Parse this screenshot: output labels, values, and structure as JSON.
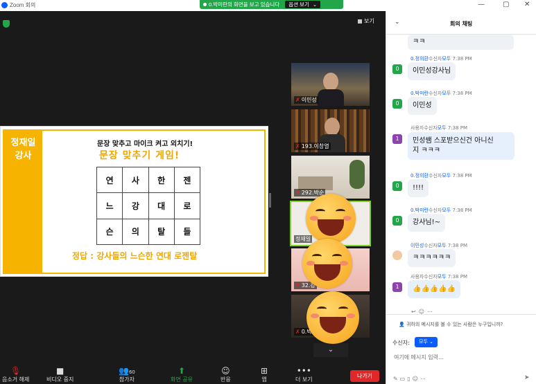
{
  "window": {
    "title": "Zoom 회의"
  },
  "share_banner": {
    "text": "0.박미란의 화면을 보고 있습니다",
    "options_label": "옵션 보기"
  },
  "meeting": {
    "view_label": "보기"
  },
  "slide": {
    "side_text_line1": "정재일",
    "side_text_line2": "강사",
    "question": "문장 맞추고 마이크 켜고 외치기!",
    "title": "문장 맞추기 게임!",
    "grid": [
      [
        "연",
        "사",
        "한",
        "젠"
      ],
      [
        "느",
        "강",
        "대",
        "로"
      ],
      [
        "슨",
        "의",
        "탈",
        "들"
      ]
    ],
    "answer": "정답 : 강사들의 느슨한 연대 로젠탈"
  },
  "participants": [
    {
      "name": "이민성",
      "muted": true
    },
    {
      "name": "193.이창열",
      "muted": true
    },
    {
      "name": "292.박순",
      "muted": true
    },
    {
      "name": "정재일",
      "muted": false
    },
    {
      "name": "32.강",
      "muted": true
    },
    {
      "name": "0.박",
      "muted": true
    }
  ],
  "toolbar": {
    "items": [
      {
        "label": "음소거 해제",
        "icon": "microphone-muted-icon"
      },
      {
        "label": "비디오 중지",
        "icon": "video-camera-icon"
      },
      {
        "label": "참가자",
        "icon": "participants-icon",
        "count": "60"
      },
      {
        "label": "화면 공유",
        "icon": "share-screen-icon"
      },
      {
        "label": "반응",
        "icon": "reaction-icon"
      },
      {
        "label": "앱",
        "icon": "apps-icon"
      },
      {
        "label": "더 보기",
        "icon": "more-icon"
      }
    ],
    "leave_label": "나가기"
  },
  "chat": {
    "title": "회의 채팅",
    "messages": [
      {
        "sender": "",
        "to": "",
        "time": "",
        "text": "ㅋㅋ",
        "avatar": ""
      },
      {
        "sender": "0.정의환",
        "to_label": "수신자",
        "to": "모두",
        "time": "7:38 PM",
        "text": "이민성강사님",
        "avatar": "0"
      },
      {
        "sender": "0.박미란",
        "to_label": "수신자",
        "to": "모두",
        "time": "7:38 PM",
        "text": "이민성",
        "avatar": "0"
      },
      {
        "sender": "사용자",
        "to_label": "수신자",
        "to": "모두",
        "time": "7:38 PM",
        "text_line1": "민성쌤 스포받으신건 아니신",
        "text_line2": "지 ㅋㅋㅋ",
        "avatar": "1"
      },
      {
        "sender": "0.정의환",
        "to_label": "수신자",
        "to": "모두",
        "time": "7:38 PM",
        "text": "!!!!",
        "avatar": "0"
      },
      {
        "sender": "0.박미란",
        "to_label": "수신자",
        "to": "모두",
        "time": "7:38 PM",
        "text": "강사님!~",
        "avatar": "0"
      },
      {
        "sender": "이민성",
        "to_label": "수신자",
        "to": "모두",
        "time": "7:38 PM",
        "text": "ㅋㅋㅋㅋㅋㅋ",
        "avatar": "photo"
      },
      {
        "sender": "사용자",
        "to_label": "수신자",
        "to": "모두",
        "time": "7:38 PM",
        "text": "👍👍👍👍👍",
        "avatar": "1"
      }
    ],
    "privacy_hint": "귀하의 메시지를 볼 수 있는 사람은 누구입니까?",
    "recipient_label": "수신자:",
    "recipient_value": "모두",
    "input_placeholder": "여기에 메시지 입력..."
  },
  "colors": {
    "zoom_blue": "#0b5cff",
    "share_green": "#23a54a",
    "leave_red": "#e02828",
    "slide_yellow": "#f6b400"
  }
}
